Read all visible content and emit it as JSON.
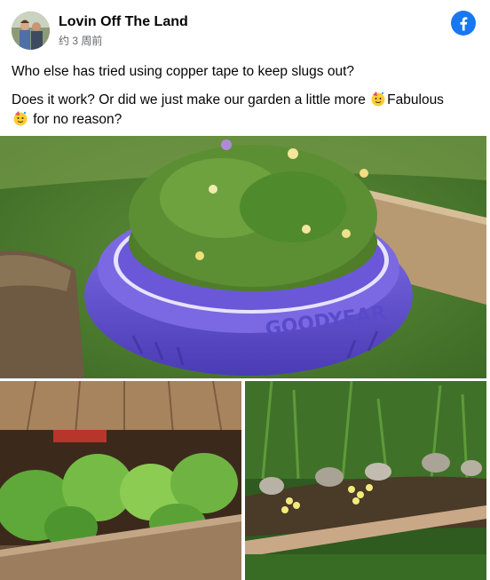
{
  "post": {
    "page_name": "Lovin Off The Land",
    "timestamp": "约 3 周前",
    "line1": "Who else has tried using copper tape to keep slugs out?",
    "line2_part1": "Does it work? Or did we just make our garden a little more ",
    "line2_part2": "Fabulous",
    "line2_part3": " for no reason?",
    "emoji": "partying-face",
    "tire_text": "GOODYEAR"
  },
  "colors": {
    "facebook_blue": "#1877f2",
    "tire_purple": "#6b5bd6",
    "text_secondary": "#65676b"
  },
  "icons": {
    "logo": "facebook-logo-icon"
  }
}
